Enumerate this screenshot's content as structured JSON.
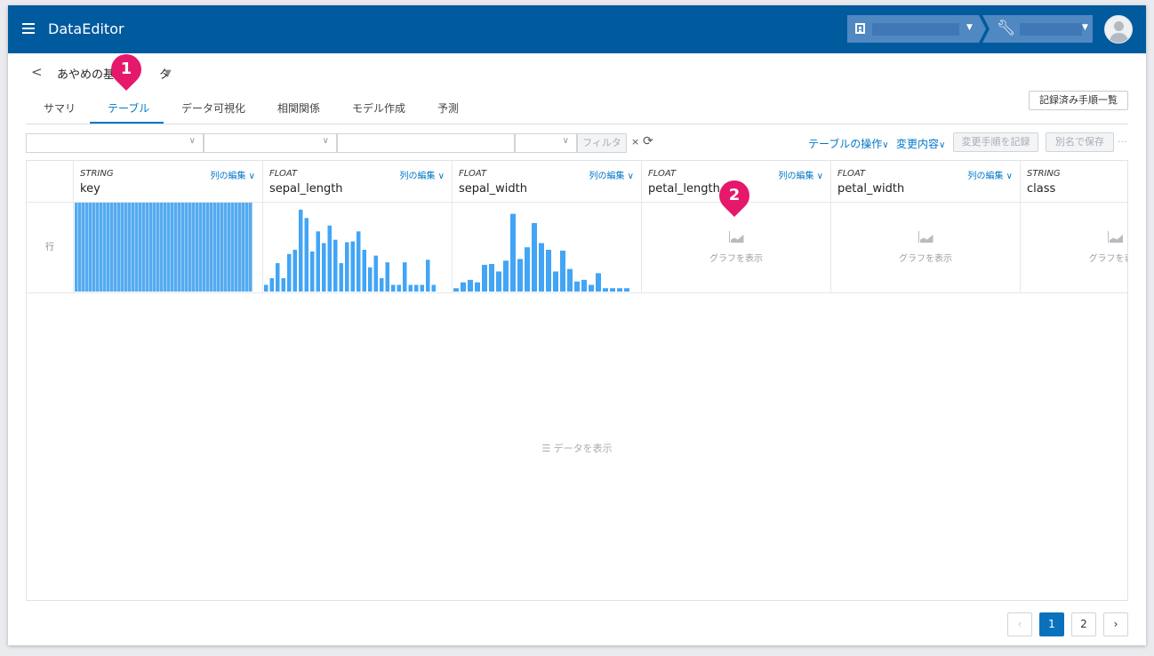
{
  "app": {
    "title": "DataEditor"
  },
  "header": {
    "org_icon": "building-icon",
    "project_icon": "wrench-icon",
    "avatar_icon": "user-avatar-icon"
  },
  "dataset": {
    "name": "あやめの基本データ",
    "name_visible": "あやめの基",
    "name_tail": "タ"
  },
  "tabs": [
    {
      "label": "サマリ"
    },
    {
      "label": "テーブル",
      "active": true
    },
    {
      "label": "データ可視化"
    },
    {
      "label": "相関関係"
    },
    {
      "label": "モデル作成"
    },
    {
      "label": "予測"
    }
  ],
  "toolbar": {
    "history_label": "記録済み手順一覧",
    "filter_label": "フィルタ",
    "clear_label": "×",
    "table_ops_label": "テーブルの操作",
    "changes_label": "変更内容",
    "record_steps_label": "変更手順を記録",
    "save_as_label": "別名で保存",
    "more_label": "···"
  },
  "table": {
    "row_label": "行",
    "edit_label": "列の編集",
    "show_graph_label": "グラフを表示",
    "show_data_label": "データを表示",
    "columns": [
      {
        "type": "STRING",
        "name": "key"
      },
      {
        "type": "FLOAT",
        "name": "sepal_length"
      },
      {
        "type": "FLOAT",
        "name": "sepal_width"
      },
      {
        "type": "FLOAT",
        "name": "petal_length"
      },
      {
        "type": "FLOAT",
        "name": "petal_width"
      },
      {
        "type": "STRING",
        "name": "class"
      }
    ]
  },
  "histograms": {
    "sepal_length": [
      0.08,
      0.16,
      0.34,
      0.16,
      0.45,
      0.5,
      0.98,
      0.88,
      0.48,
      0.72,
      0.58,
      0.79,
      0.62,
      0.34,
      0.59,
      0.6,
      0.72,
      0.5,
      0.29,
      0.43,
      0.16,
      0.35,
      0.08,
      0.08,
      0.35,
      0.08,
      0.08,
      0.08,
      0.38,
      0.08
    ],
    "sepal_width": [
      0.04,
      0.11,
      0.14,
      0.11,
      0.32,
      0.33,
      0.24,
      0.37,
      0.93,
      0.39,
      0.53,
      0.82,
      0.58,
      0.5,
      0.24,
      0.49,
      0.27,
      0.12,
      0.14,
      0.08,
      0.22,
      0.04,
      0.04,
      0.04,
      0.04
    ]
  },
  "pagination": {
    "prev": "‹",
    "pages": [
      "1",
      "2"
    ],
    "current": "1",
    "next": "›"
  },
  "callouts": [
    "1",
    "2"
  ],
  "colors": {
    "appbar": "#005a9e",
    "accent": "#0077c8",
    "histogram": "#42a5f5",
    "callout": "#e5186c"
  }
}
